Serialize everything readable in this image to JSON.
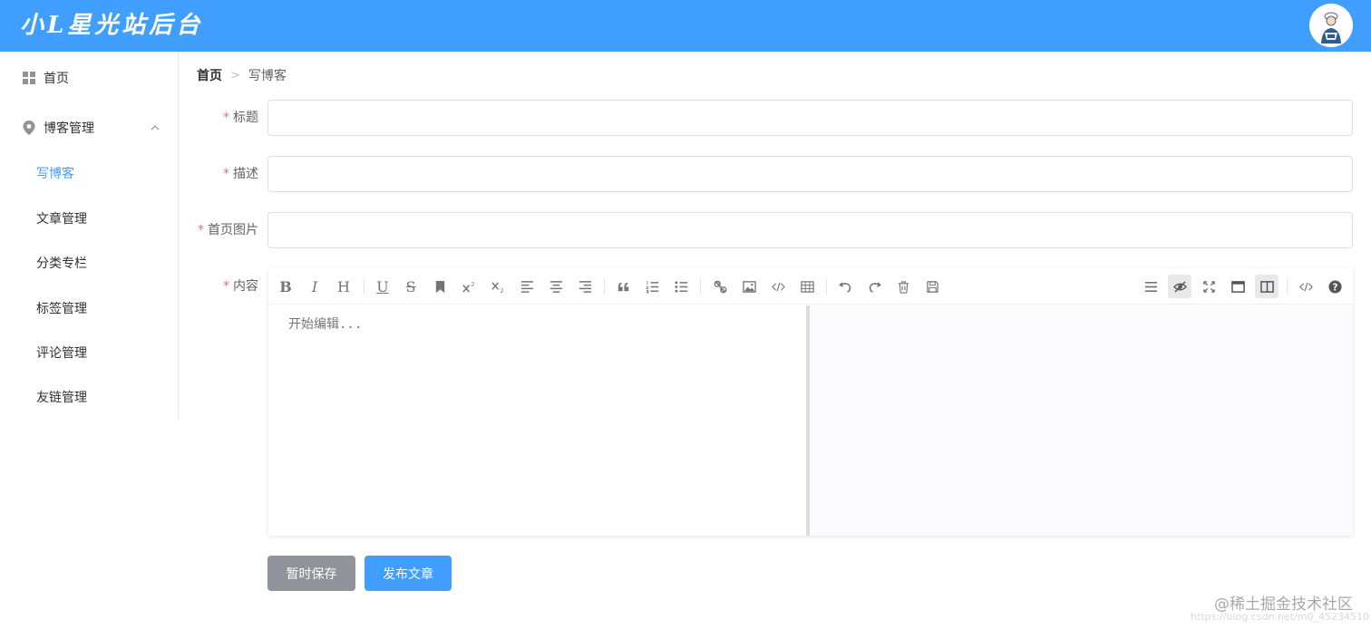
{
  "header": {
    "logo_text": "小L星光站后台",
    "bg_color": "#409eff",
    "avatar_icon": "user-avatar-icon"
  },
  "sidebar": {
    "items": [
      {
        "label": "首页",
        "icon": "grid-icon"
      },
      {
        "label": "博客管理",
        "icon": "location-icon",
        "expanded": true
      },
      {
        "label": "写博客",
        "active": true
      },
      {
        "label": "文章管理"
      },
      {
        "label": "分类专栏"
      },
      {
        "label": "标签管理"
      },
      {
        "label": "评论管理"
      },
      {
        "label": "友链管理"
      }
    ]
  },
  "breadcrumb": {
    "home": "首页",
    "separator": ">",
    "current": "写博客"
  },
  "form": {
    "title": {
      "label": "标题",
      "value": ""
    },
    "description": {
      "label": "描述",
      "value": ""
    },
    "cover": {
      "label": "首页图片",
      "value": ""
    },
    "content": {
      "label": "内容",
      "placeholder": "开始编辑..."
    }
  },
  "editor": {
    "text_buttons": {
      "bold": "B",
      "italic": "I",
      "header": "H",
      "underline": "U",
      "strikethrough": "S"
    },
    "toolbar_icons": [
      "bold-icon",
      "italic-icon",
      "header-icon",
      "underline-icon",
      "strikethrough-icon",
      "mark-icon",
      "superscript-icon",
      "subscript-icon",
      "align-left-icon",
      "align-center-icon",
      "align-right-icon",
      "quote-icon",
      "ordered-list-icon",
      "unordered-list-icon",
      "link-icon",
      "image-icon",
      "code-icon",
      "table-icon",
      "undo-icon",
      "redo-icon",
      "trash-icon",
      "save-icon",
      "navigation-icon",
      "preview-toggle-icon",
      "fullscreen-icon",
      "read-mode-icon",
      "subfield-icon",
      "html-code-icon",
      "help-icon"
    ],
    "preview_bg": "#fbfbfd"
  },
  "actions": {
    "save_label": "暂时保存",
    "publish_label": "发布文章",
    "save_color": "#909399",
    "publish_color": "#409eff"
  },
  "watermark": {
    "text": "@稀土掘金技术社区",
    "url": "https://blog.csdn.net/m0_45234510"
  }
}
